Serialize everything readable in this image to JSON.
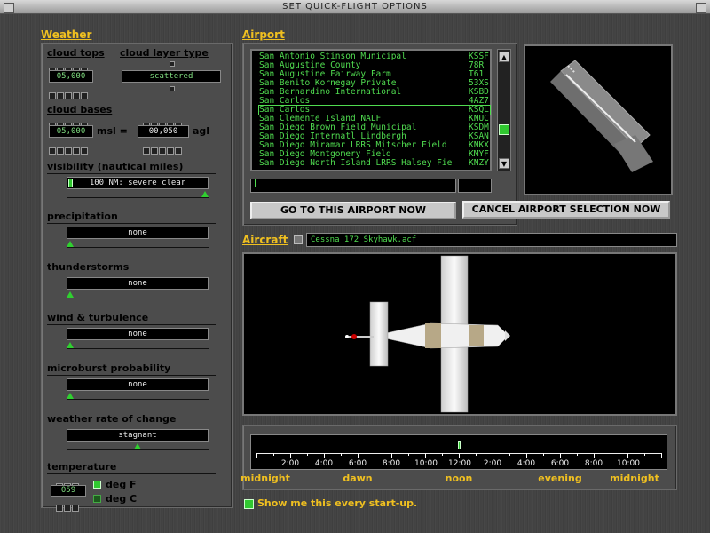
{
  "window": {
    "title": "SET QUICK-FLIGHT OPTIONS"
  },
  "weather": {
    "section_title": "Weather",
    "cloud_tops": {
      "label": "cloud tops",
      "value": "05,000"
    },
    "cloud_layer_type": {
      "label": "cloud layer type",
      "value": "scattered"
    },
    "cloud_bases": {
      "label": "cloud bases",
      "msl_value": "05,000",
      "msl_label": "msl =",
      "agl_value": "00,050",
      "agl_label": "agl"
    },
    "visibility": {
      "label": "visibility (nautical miles)",
      "value": "100 NM: severe clear",
      "level": 1.0
    },
    "precipitation": {
      "label": "precipitation",
      "value": "none",
      "level": 0.0
    },
    "thunderstorms": {
      "label": "thunderstorms",
      "value": "none",
      "level": 0.0
    },
    "wind": {
      "label": "wind & turbulence",
      "value": "none",
      "level": 0.0
    },
    "microburst": {
      "label": "microburst probability",
      "value": "none",
      "level": 0.0
    },
    "rate_of_change": {
      "label": "weather rate of change",
      "value": "stagnant",
      "level": 0.5
    },
    "temperature": {
      "label": "temperature",
      "value": "059",
      "unit_f": "deg F",
      "unit_c": "deg C",
      "selected_unit": "F"
    }
  },
  "airport": {
    "section_title": "Airport",
    "list": [
      {
        "name": "San Antonio Stinson Municipal",
        "code": "KSSF"
      },
      {
        "name": "San Augustine County",
        "code": "78R"
      },
      {
        "name": "San Augustine Fairway Farm",
        "code": "T61"
      },
      {
        "name": "San Benito Kornegay   Private",
        "code": "53XS"
      },
      {
        "name": "San Bernardino International",
        "code": "KSBD"
      },
      {
        "name": "San Carlos",
        "code": "4AZ7"
      },
      {
        "name": "San Carlos",
        "code": "KSQL"
      },
      {
        "name": "San Clemente Island NALF",
        "code": "KNUC"
      },
      {
        "name": "San Diego Brown Field Municipal",
        "code": "KSDM"
      },
      {
        "name": "San Diego Internatl Lindbergh",
        "code": "KSAN"
      },
      {
        "name": "San Diego Miramar LRRS Mitscher Field",
        "code": "KNKX"
      },
      {
        "name": "San Diego Montgomery Field",
        "code": "KMYF"
      },
      {
        "name": "San Diego North Island LRRS Halsey Fie",
        "code": "KNZY"
      }
    ],
    "selected_index": 6,
    "search_value": "",
    "code_value": "",
    "go_button": "GO TO THIS AIRPORT NOW",
    "cancel_button": "CANCEL AIRPORT SELECTION NOW"
  },
  "aircraft": {
    "section_title": "Aircraft",
    "file": "Cessna 172 Skyhawk.acf"
  },
  "time": {
    "ticks": [
      "2:00",
      "4:00",
      "6:00",
      "8:00",
      "10:00",
      "12:00",
      "2:00",
      "4:00",
      "6:00",
      "8:00",
      "10:00"
    ],
    "periods": [
      "midnight",
      "dawn",
      "noon",
      "evening",
      "midnight"
    ],
    "current_fraction": 0.5
  },
  "startup": {
    "label": "Show me this every start-up.",
    "checked": true
  },
  "colors": {
    "accent": "#f0c020",
    "lcd_green": "#50dc50",
    "led": "#30c830"
  }
}
